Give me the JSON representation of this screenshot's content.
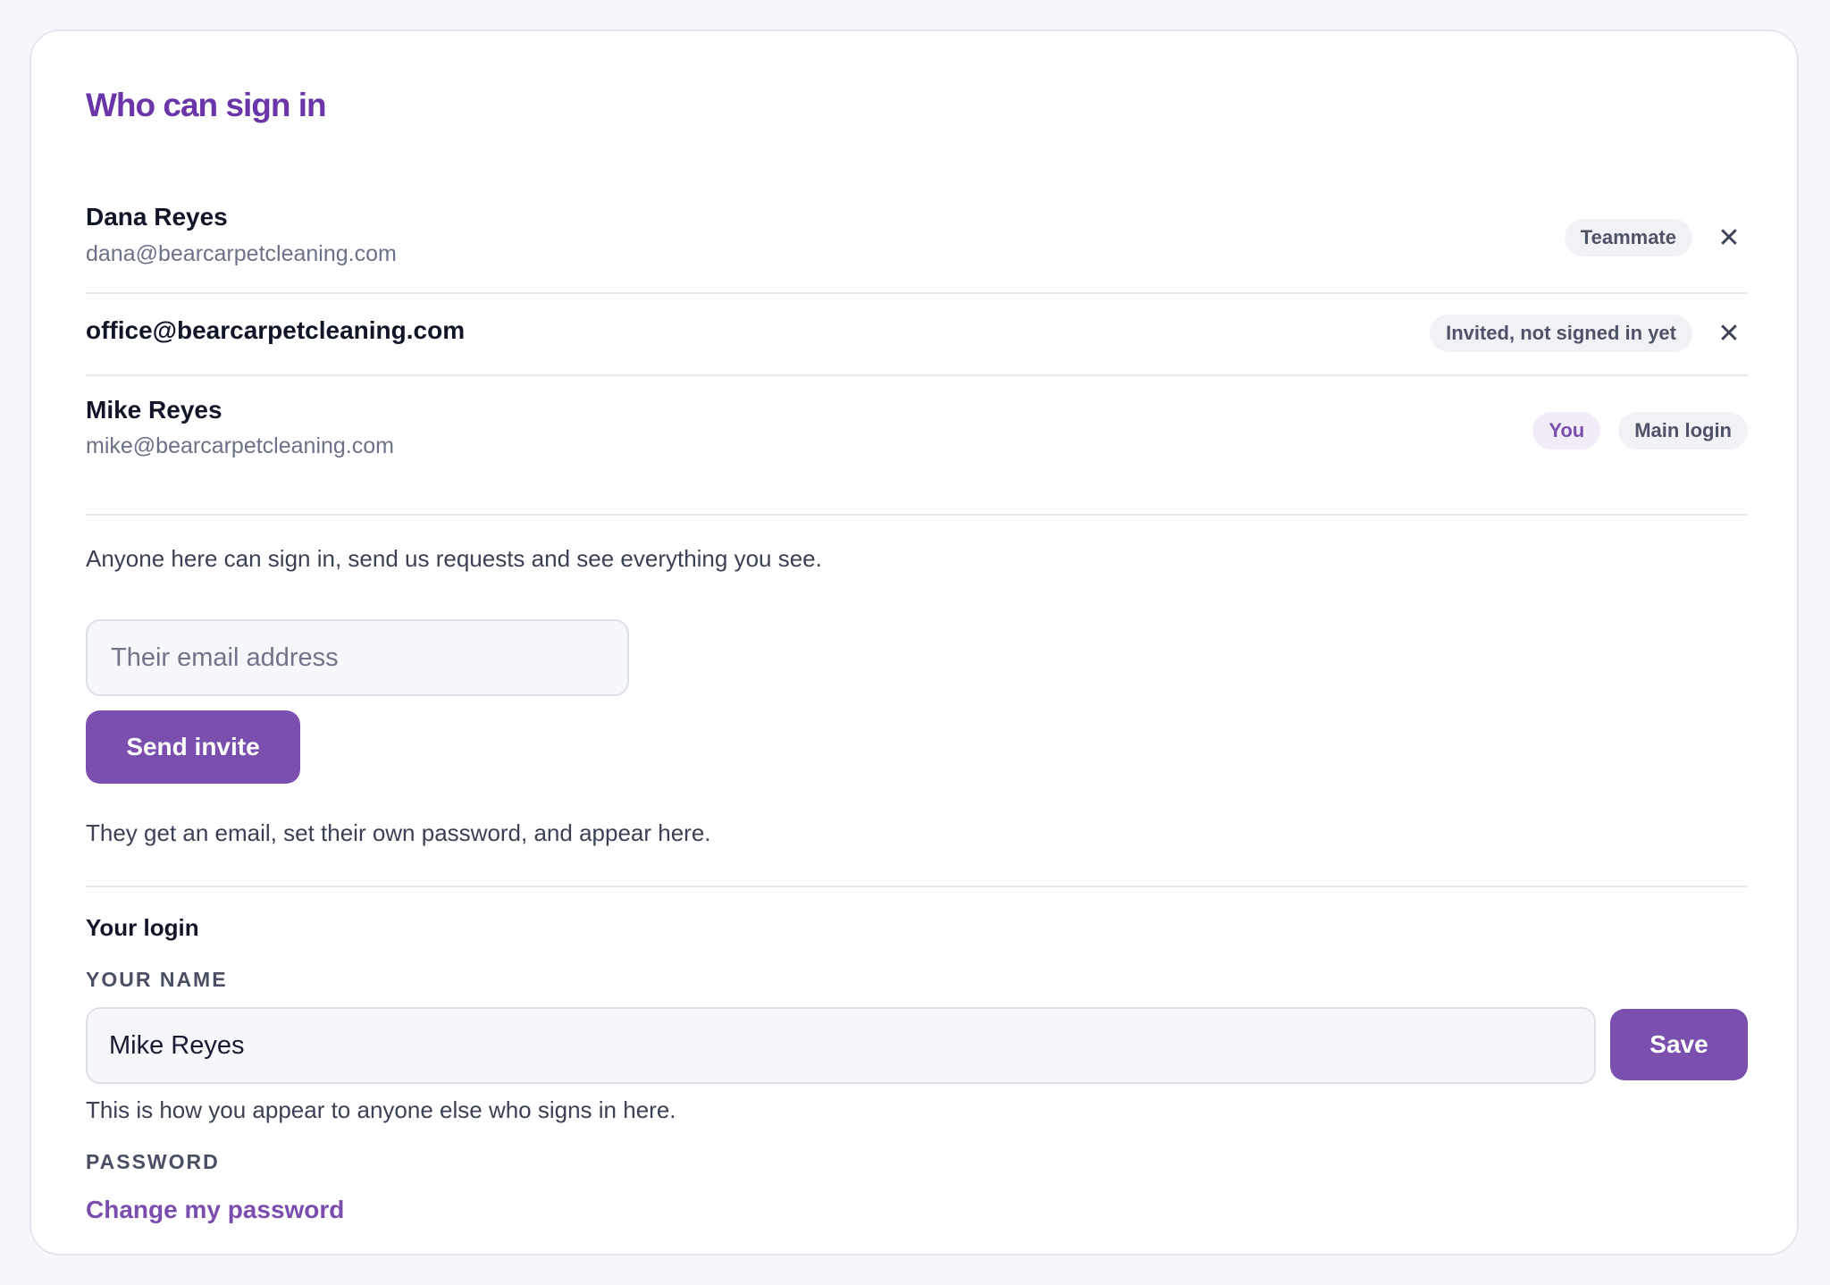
{
  "section": {
    "title": "Who can sign in"
  },
  "members": [
    {
      "name": "Dana Reyes",
      "email": "dana@bearcarpetcleaning.com",
      "badges": [
        "Teammate"
      ],
      "removable": true
    },
    {
      "name": "office@bearcarpetcleaning.com",
      "email": "",
      "badges": [
        "Invited, not signed in yet"
      ],
      "removable": true
    },
    {
      "name": "Mike Reyes",
      "email": "mike@bearcarpetcleaning.com",
      "badges": [
        "You",
        "Main login"
      ],
      "removable": false
    }
  ],
  "remove_glyph": "✕",
  "access_note": "Anyone here can sign in, send us requests and see everything you see.",
  "invite": {
    "placeholder": "Their email address",
    "button_label": "Send invite",
    "note": "They get an email, set their own password, and appear here."
  },
  "your_login": {
    "title": "Your login",
    "name_label": "YOUR NAME",
    "name_value": "Mike Reyes",
    "save_label": "Save",
    "name_note": "This is how you appear to anyone else who signs in here.",
    "password_label": "PASSWORD",
    "change_password_label": "Change my password"
  },
  "colors": {
    "accent": "#7b4fae",
    "title": "#6a35a8",
    "you_badge_bg": "#f2ecf9"
  },
  "icons": {
    "remove": "close-icon"
  }
}
